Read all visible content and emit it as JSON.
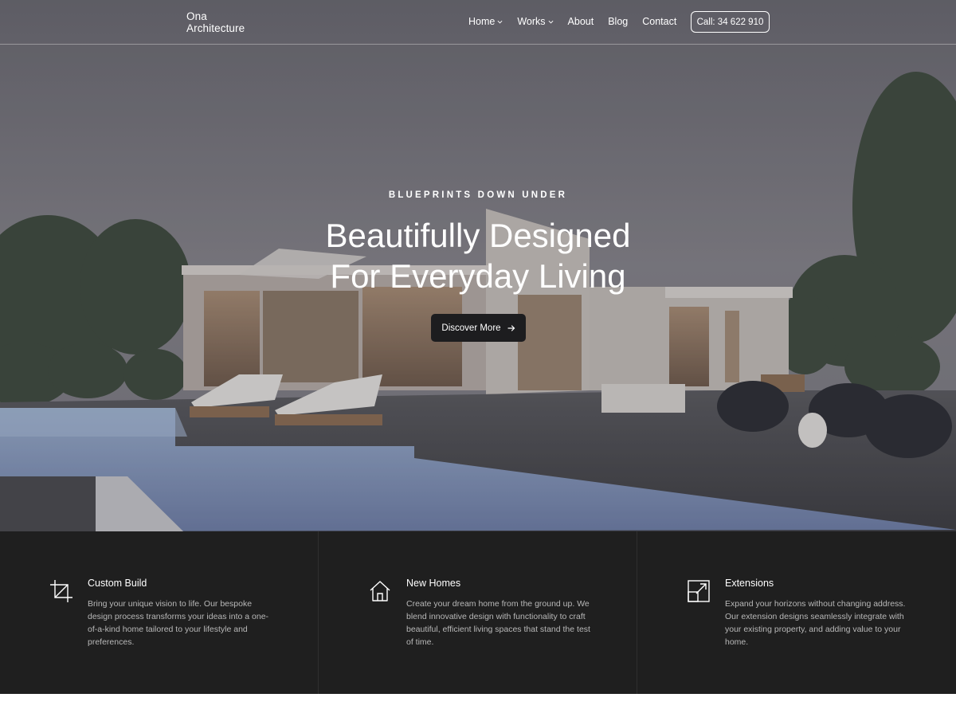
{
  "brand": {
    "line1": "Ona",
    "line2": "Architecture"
  },
  "nav": {
    "items": [
      {
        "label": "Home",
        "has_dropdown": true
      },
      {
        "label": "Works",
        "has_dropdown": true
      },
      {
        "label": "About",
        "has_dropdown": false
      },
      {
        "label": "Blog",
        "has_dropdown": false
      },
      {
        "label": "Contact",
        "has_dropdown": false
      }
    ],
    "call_label": "Call: 34 622 910"
  },
  "hero": {
    "eyebrow": "BLUEPRINTS DOWN UNDER",
    "headline_line1": "Beautifully Designed",
    "headline_line2": "For Everyday Living",
    "cta_label": "Discover More",
    "cta_icon": "arrow-right-icon"
  },
  "features": [
    {
      "icon": "crop-icon",
      "title": "Custom Build",
      "text": "Bring your unique vision to life. Our bespoke design process transforms your ideas into a one-of-a-kind home tailored to your lifestyle and preferences."
    },
    {
      "icon": "house-icon",
      "title": "New Homes",
      "text": "Create your dream home from the ground up. We blend innovative design with functionality to craft beautiful, efficient living spaces that stand the test of time."
    },
    {
      "icon": "expand-arrow-icon",
      "title": "Extensions",
      "text": "Expand your horizons without changing address. Our extension designs seamlessly integrate with your existing property, and adding value to your home."
    }
  ],
  "colors": {
    "feature_bg": "#1f1f1f",
    "button_dark": "#1d1d1f",
    "text_muted": "#b8b8b8"
  }
}
